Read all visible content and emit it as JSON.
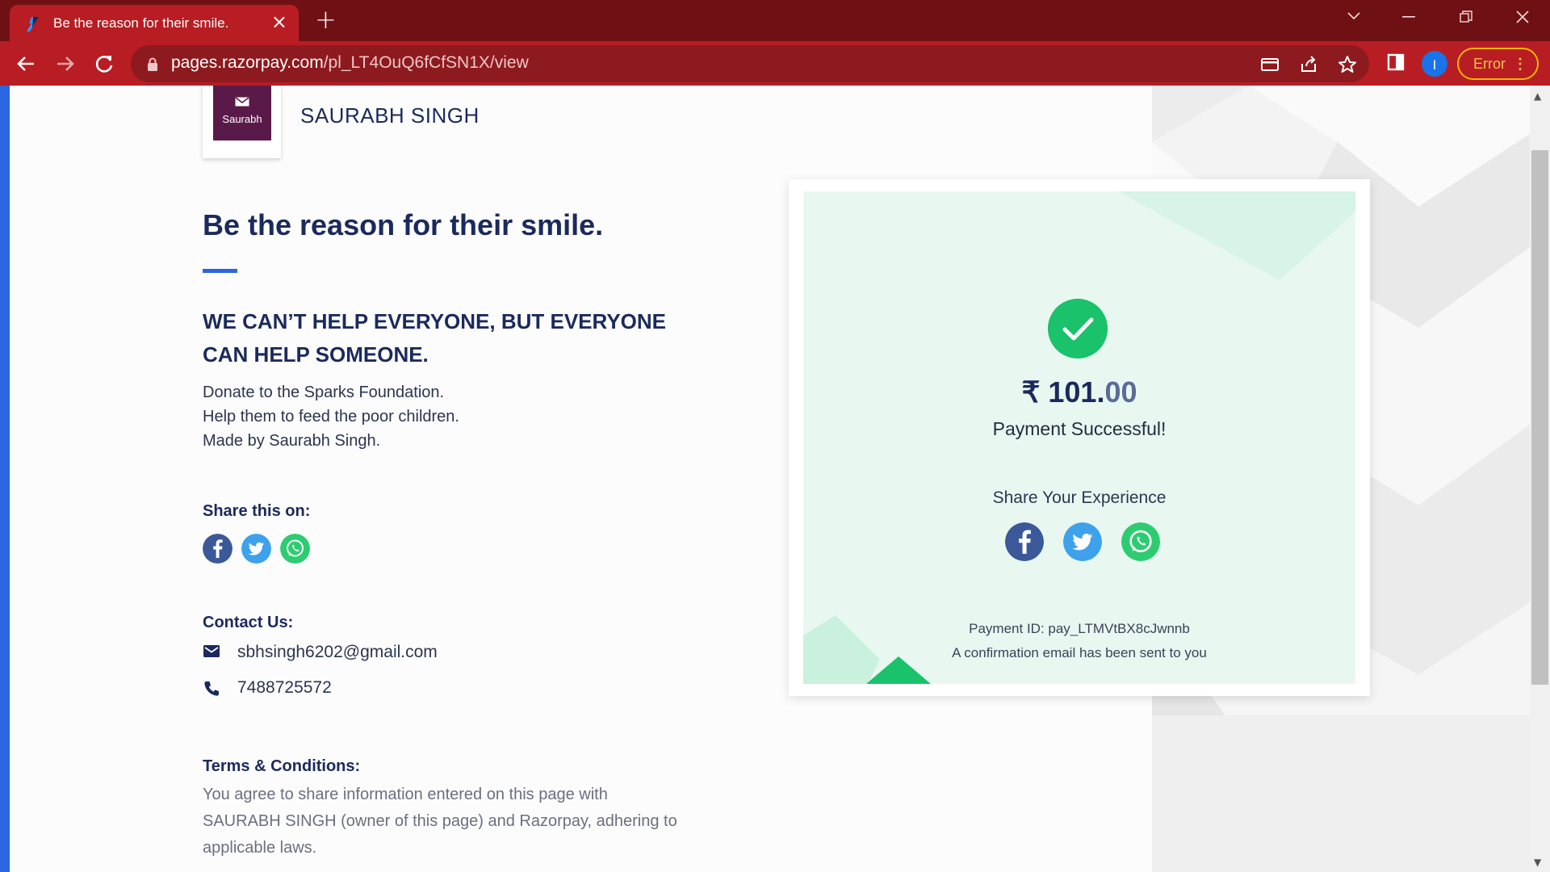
{
  "browser": {
    "tab_title": "Be the reason for their smile.",
    "url_host": "pages.razorpay.com",
    "url_path": "/pl_LT4OuQ6fCfSN1X/view",
    "profile_initial": "I",
    "error_label": "Error",
    "colors": {
      "tabbar": "#6f1114",
      "toolbar": "#b71d23"
    }
  },
  "merchant": {
    "logo_text": "Saurabh",
    "name": "SAURABH SINGH"
  },
  "page": {
    "title": "Be the reason for their smile.",
    "headline": "WE CAN’T HELP EVERYONE, BUT EVERYONE CAN HELP SOMEONE.",
    "description": [
      "Donate to the Sparks Foundation.",
      "Help them to feed the poor children.",
      "Made by Saurabh Singh."
    ],
    "share_heading": "Share this on:",
    "contact_heading": "Contact Us:",
    "contact_email": "sbhsingh6202@gmail.com",
    "contact_phone": "7488725572",
    "terms_heading": "Terms & Conditions:",
    "terms_text": "You agree to share information entered on this page with SAURABH SINGH (owner of this page) and Razorpay, adhering to applicable laws."
  },
  "payment": {
    "currency_symbol": "₹",
    "amount_rupees": "101.",
    "amount_paise": "00",
    "status": "Payment Successful!",
    "share_label": "Share Your Experience",
    "payment_id": "Payment ID: pay_LTMVtBX8cJwnnb",
    "confirmation": "A confirmation email has been sent to you"
  },
  "colors": {
    "brand_blue": "#2b66e3",
    "navy_text": "#1b2a5c",
    "success_green": "#19c26b",
    "facebook": "#3b5998",
    "twitter": "#3ea1ec",
    "whatsapp": "#2ecc71"
  }
}
